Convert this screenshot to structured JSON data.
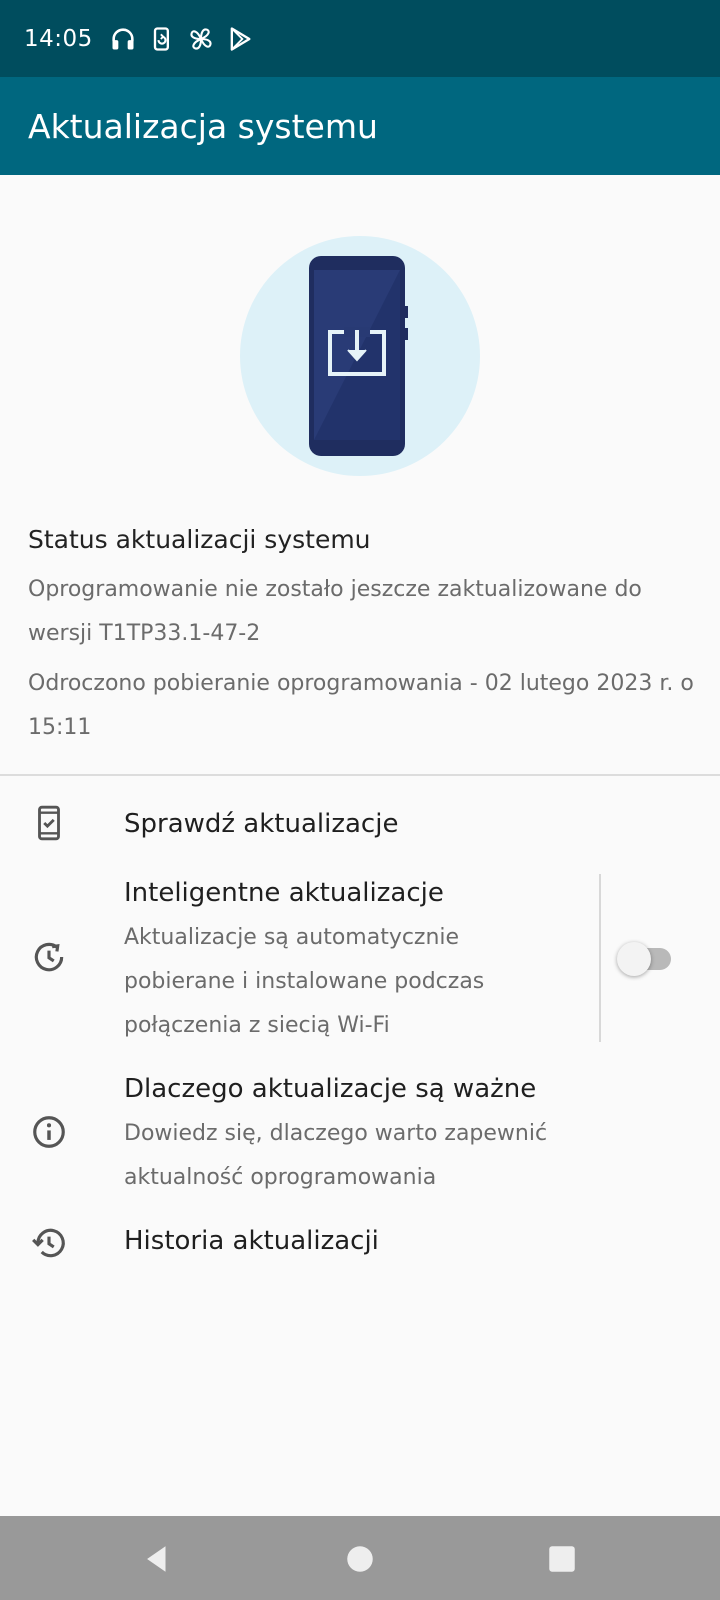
{
  "status_bar": {
    "time": "14:05",
    "icons": [
      "headphones-icon",
      "screen-rotate-icon",
      "pinwheel-icon",
      "play-store-icon"
    ]
  },
  "app_bar": {
    "title": "Aktualizacja systemu"
  },
  "hero": {
    "icon": "phone-download-icon"
  },
  "status_section": {
    "title": "Status aktualizacji systemu",
    "line1": "Oprogramowanie nie zostało jeszcze zaktualizowane do wersji T1TP33.1-47-2",
    "line2": "Odroczono pobieranie oprogramowania - 02 lutego 2023 r. o 15:11"
  },
  "items": [
    {
      "icon": "phone-check-icon",
      "title": "Sprawdź aktualizacje"
    },
    {
      "icon": "clock-refresh-icon",
      "title": "Inteligentne aktualizacje",
      "subtitle": "Aktualizacje są automatycznie pobierane i instalowane podczas połączenia z siecią Wi-Fi",
      "toggle": false
    },
    {
      "icon": "info-icon",
      "title": "Dlaczego aktualizacje są ważne",
      "subtitle": "Dowiedz się, dlaczego warto zapewnić aktualność oprogramowania"
    },
    {
      "icon": "history-icon",
      "title": "Historia aktualizacji"
    }
  ],
  "nav_bar": {
    "buttons": [
      "back-icon",
      "home-icon",
      "recents-icon"
    ]
  },
  "colors": {
    "status_bar": "#004d5e",
    "app_bar": "#00677f",
    "hero_circle": "#ddf1f8",
    "phone_body": "#22336b"
  }
}
